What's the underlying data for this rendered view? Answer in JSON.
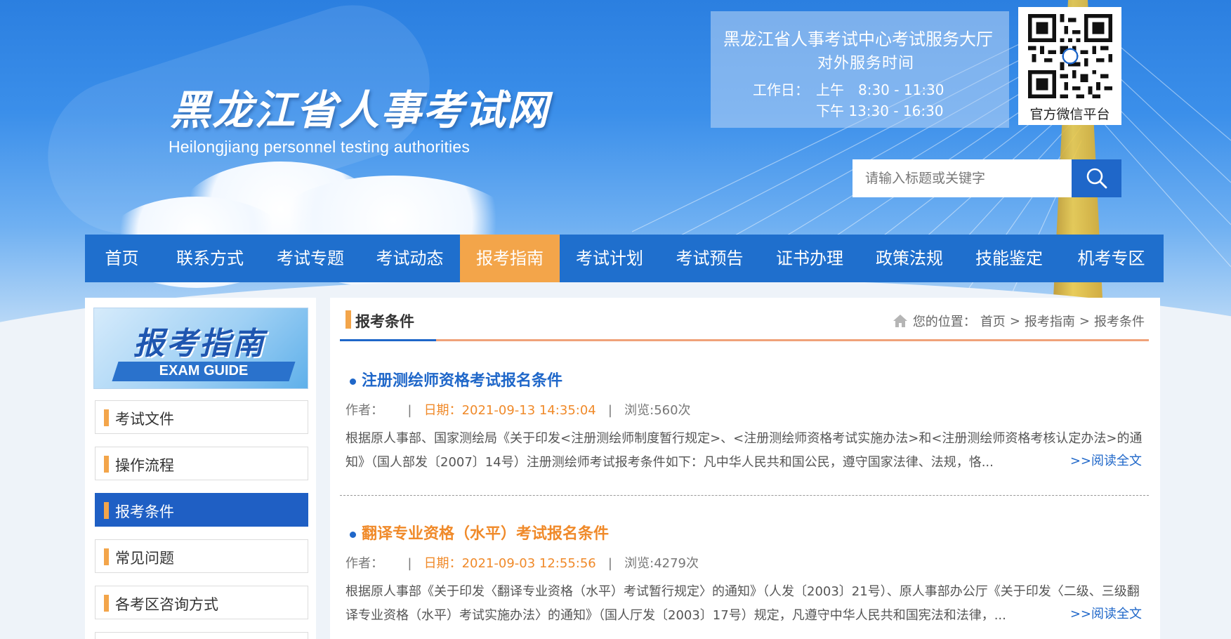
{
  "header": {
    "site_title": "黑龙江省人事考试网",
    "site_subtitle": "Heilongjiang personnel testing authorities",
    "service": {
      "title": "黑龙江省人事考试中心考试服务大厅",
      "subtitle": "对外服务时间",
      "workday_label": "工作日：",
      "am": "上午　8:30 - 11:30",
      "pm": "下午 13:30 - 16:30"
    },
    "qr_label": "官方微信平台",
    "search": {
      "placeholder": "请输入标题或关键字",
      "icon": "search-icon"
    }
  },
  "nav": {
    "items": [
      {
        "label": "首页"
      },
      {
        "label": "联系方式"
      },
      {
        "label": "考试专题"
      },
      {
        "label": "考试动态"
      },
      {
        "label": "报考指南",
        "active": true
      },
      {
        "label": "考试计划"
      },
      {
        "label": "考试预告"
      },
      {
        "label": "证书办理"
      },
      {
        "label": "政策法规"
      },
      {
        "label": "技能鉴定"
      },
      {
        "label": "机考专区"
      }
    ],
    "active_color": "#f3a54a",
    "bar_color": "#1f6fcd"
  },
  "sidebar": {
    "banner_cn": "报考指南",
    "banner_en": "EXAM GUIDE",
    "items": [
      {
        "label": "考试文件"
      },
      {
        "label": "操作流程"
      },
      {
        "label": "报考条件",
        "active": true
      },
      {
        "label": "常见问题"
      },
      {
        "label": "各考区咨询方式"
      }
    ]
  },
  "main": {
    "section_title": "报考条件",
    "breadcrumb": {
      "prefix": "您的位置：",
      "items": [
        "首页",
        "报考指南",
        "报考条件"
      ],
      "separator": ">"
    },
    "articles": [
      {
        "title": "注册测绘师资格考试报名条件",
        "title_color": "#1f67c9",
        "author_label": "作者：",
        "date_label": "日期：",
        "date": "2021-09-13 14:35:04",
        "views": "浏览:560次",
        "summary": "根据原人事部、国家测绘局《关于印发<注册测绘师制度暂行规定>、<注册测绘师资格考试实施办法>和<注册测绘师资格考核认定办法>的通知》（国人部发〔2007〕14号）注册测绘师考试报考条件如下：凡中华人民共和国公民，遵守国家法律、法规，恪...",
        "read_more": ">>阅读全文"
      },
      {
        "title": "翻译专业资格（水平）考试报名条件",
        "title_color": "#f08a2a",
        "author_label": "作者：",
        "date_label": "日期：",
        "date": "2021-09-03 12:55:56",
        "views": "浏览:4279次",
        "summary": "根据原人事部《关于印发〈翻译专业资格（水平）考试暂行规定〉的通知》（人发〔2003〕21号）、原人事部办公厅《关于印发〈二级、三级翻译专业资格（水平）考试实施办法〉的通知》（国人厅发〔2003〕17号）规定，凡遵守中华人民共和国宪法和法律，...",
        "read_more": ">>阅读全文"
      }
    ]
  }
}
